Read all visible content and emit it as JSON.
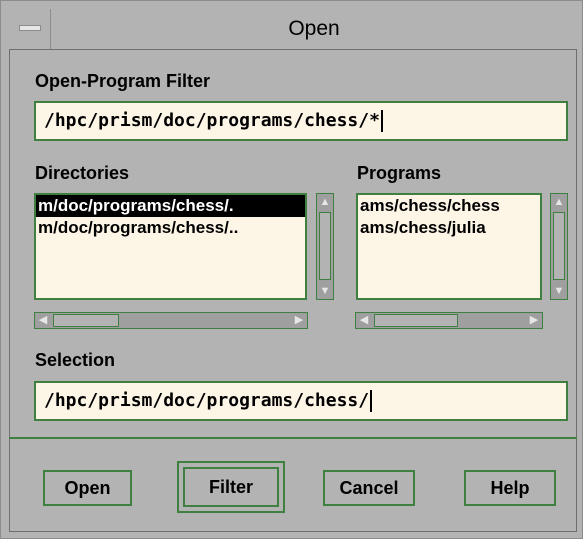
{
  "window": {
    "title": "Open"
  },
  "filter": {
    "label": "Open-Program Filter",
    "value": "/hpc/prism/doc/programs/chess/*"
  },
  "directories": {
    "label": "Directories",
    "items": [
      "m/doc/programs/chess/.",
      "m/doc/programs/chess/.."
    ],
    "selected_index": 0
  },
  "programs": {
    "label": "Programs",
    "items": [
      "ams/chess/chess",
      "ams/chess/julia"
    ]
  },
  "selection": {
    "label": "Selection",
    "value": "/hpc/prism/doc/programs/chess/"
  },
  "buttons": {
    "open": "Open",
    "filter": "Filter",
    "cancel": "Cancel",
    "help": "Help"
  },
  "icons": {
    "window_menu": "window-menu-icon",
    "arrow_up": "arrow-up-icon",
    "arrow_down": "arrow-down-icon",
    "arrow_left": "arrow-left-icon",
    "arrow_right": "arrow-right-icon"
  }
}
